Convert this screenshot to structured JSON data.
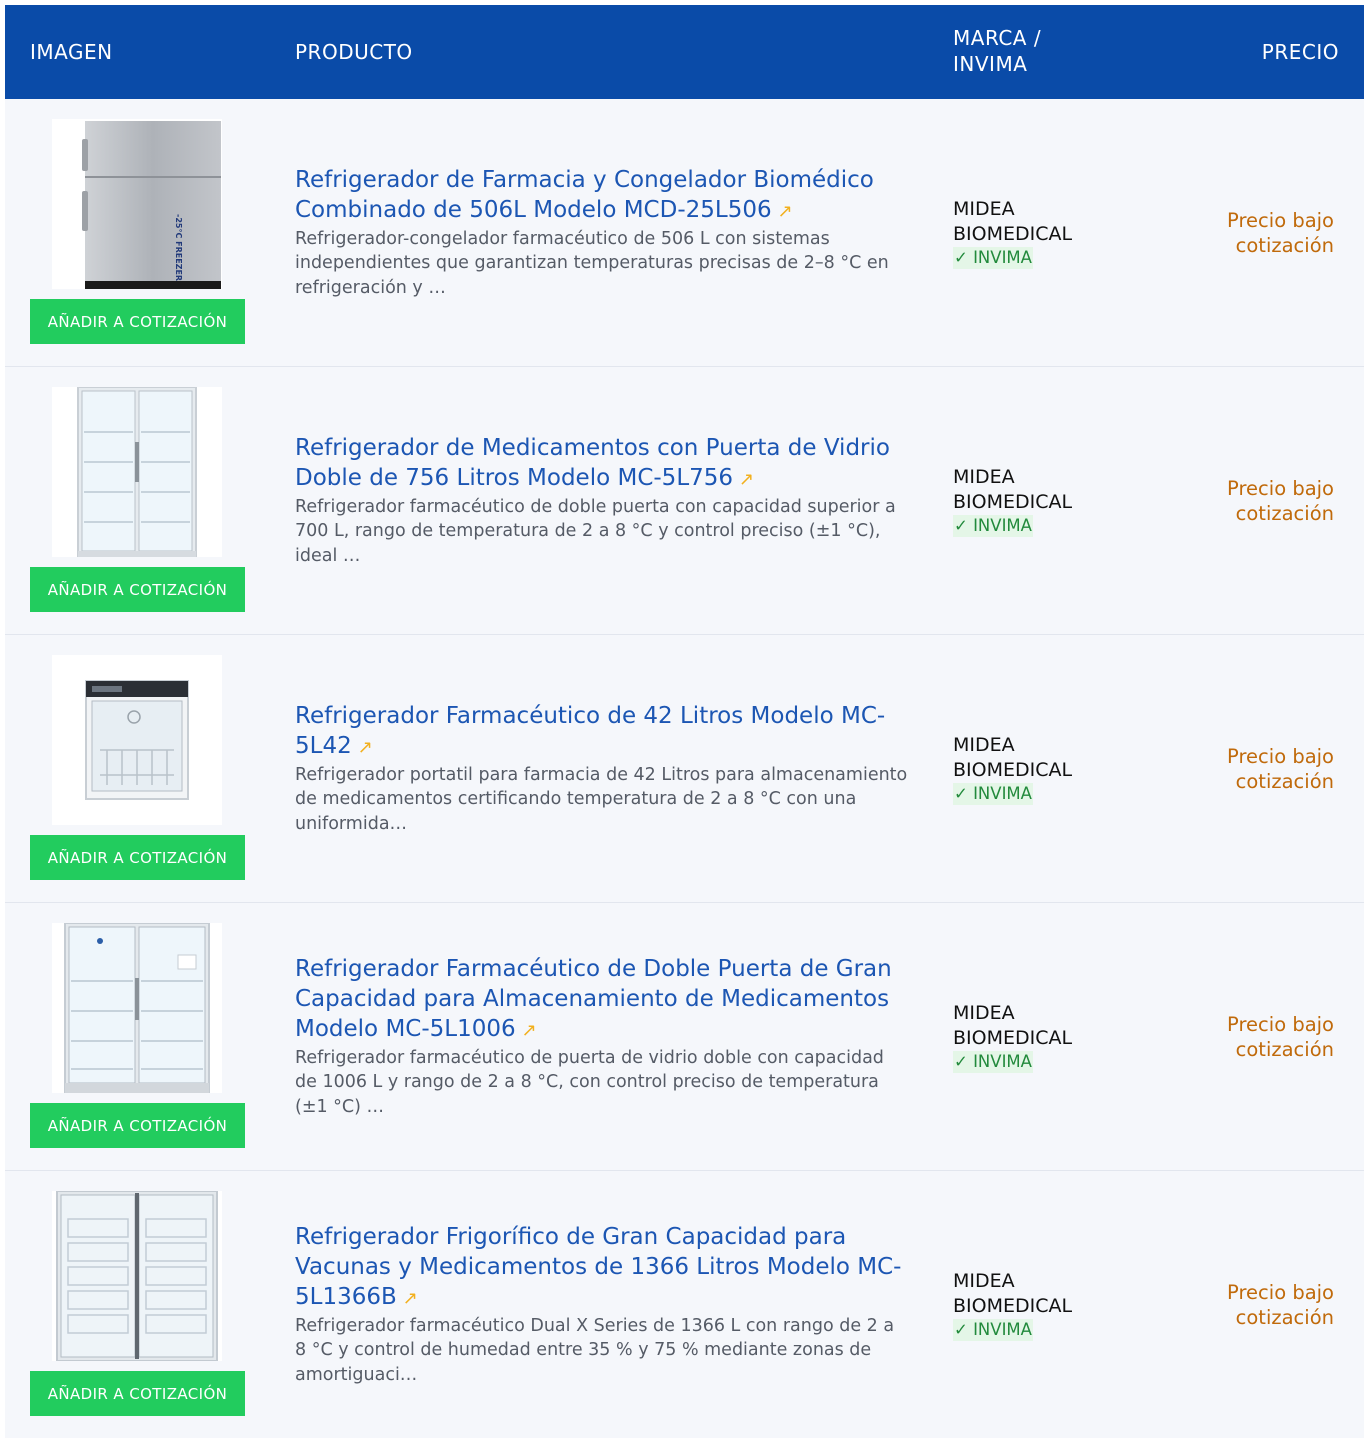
{
  "table": {
    "headers": {
      "image": "IMAGEN",
      "product": "PRODUCTO",
      "brand": "MARCA / INVIMA",
      "price": "PRECIO"
    }
  },
  "rows": [
    {
      "title": "Refrigerador de Farmacia y Congelador Biomédico Combinado de 506L Modelo MCD-25L506",
      "description": "Refrigerador-congelador farmacéutico de 506 L con sistemas independientes que garantizan temperaturas precisas de 2–8 °C en refrigeración y …",
      "brand": "MIDEA BIOMEDICAL",
      "invima": "✓ INVIMA",
      "price": "Precio bajo cotización",
      "button": "AÑADIR A COTIZACIÓN",
      "image_icon": "combo-fridge-freezer-image",
      "image_text": "-25°C FREEZER"
    },
    {
      "title": "Refrigerador de Medicamentos con Puerta de Vidrio Doble de 756 Litros Modelo MC-5L756",
      "description": "Refrigerador farmacéutico de doble puerta con capacidad superior a 700 L, rango de temperatura de 2 a 8 °C y control preciso (±1 °C), ideal …",
      "brand": "MIDEA BIOMEDICAL",
      "invima": "✓ INVIMA",
      "price": "Precio bajo cotización",
      "button": "AÑADIR A COTIZACIÓN",
      "image_icon": "double-glass-door-fridge-image"
    },
    {
      "title": "Refrigerador Farmacéutico de 42 Litros Modelo MC-5L42",
      "description": "Refrigerador portatil para farmacia de 42 Litros para almacenamiento de medicamentos certificando temperatura de 2 a 8 °C con una uniformida…",
      "brand": "MIDEA BIOMEDICAL",
      "invima": "✓ INVIMA",
      "price": "Precio bajo cotización",
      "button": "AÑADIR A COTIZACIÓN",
      "image_icon": "small-countertop-fridge-image"
    },
    {
      "title": "Refrigerador Farmacéutico de Doble Puerta de Gran Capacidad para Almacenamiento de Medicamentos Modelo MC-5L1006",
      "description": "Refrigerador farmacéutico de puerta de vidrio doble con capacidad de 1006 L y rango de 2 a 8 °C, con control preciso de temperatura (±1 °C) …",
      "brand": "MIDEA BIOMEDICAL",
      "invima": "✓ INVIMA",
      "price": "Precio bajo cotización",
      "button": "AÑADIR A COTIZACIÓN",
      "image_icon": "large-double-door-fridge-image"
    },
    {
      "title": "Refrigerador Frigorífico de Gran Capacidad para Vacunas y Medicamentos de 1366 Litros Modelo MC-5L1366B",
      "description": "Refrigerador farmacéutico Dual X Series de 1366 L con rango de 2 a 8 °C y control de humedad entre 35 % y 75 % mediante zonas de amortiguaci…",
      "brand": "MIDEA BIOMEDICAL",
      "invima": "✓ INVIMA",
      "price": "Precio bajo cotización",
      "button": "AÑADIR A COTIZACIÓN",
      "image_icon": "tall-double-door-vaccine-fridge-image"
    }
  ],
  "icons": {
    "external_link": "↗"
  },
  "colors": {
    "header_bg": "#0a4ba8",
    "button_bg": "#22cc5e",
    "title_link": "#1c56b3",
    "price": "#c06a0b",
    "invima": "#228a3c"
  }
}
